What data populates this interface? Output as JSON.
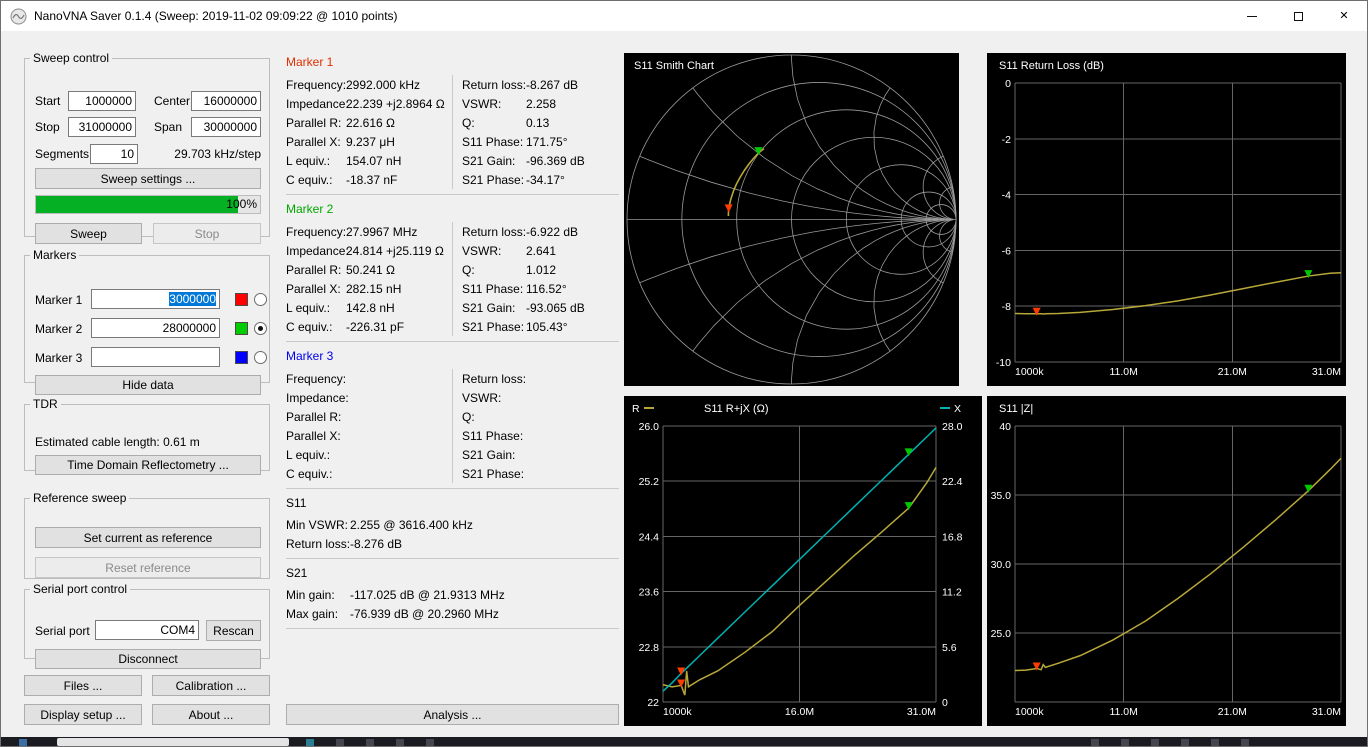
{
  "window": {
    "title": "NanoVNA Saver 0.1.4 (Sweep: 2019-11-02 09:09:22 @ 1010 points)"
  },
  "sweep_control": {
    "title": "Sweep control",
    "start_label": "Start",
    "start_value": "1000000",
    "center_label": "Center",
    "center_value": "16000000",
    "stop_label": "Stop",
    "stop_value": "31000000",
    "span_label": "Span",
    "span_value": "30000000",
    "segments_label": "Segments",
    "segments_value": "10",
    "step_info": "29.703 kHz/step",
    "sweep_settings_button": "Sweep settings ...",
    "progress_percent": 100,
    "progress_label": "100%",
    "sweep_button": "Sweep",
    "stop_button": "Stop"
  },
  "markers_panel": {
    "title": "Markers",
    "rows": [
      {
        "label": "Marker 1",
        "value": "3000000",
        "color": "#ff0000",
        "checked": false
      },
      {
        "label": "Marker 2",
        "value": "28000000",
        "color": "#00cc00",
        "checked": true
      },
      {
        "label": "Marker 3",
        "value": "",
        "color": "#0000ff",
        "checked": false
      }
    ],
    "hide_data_button": "Hide data"
  },
  "tdr": {
    "title": "TDR",
    "cable_length_text": "Estimated cable length: 0.61 m",
    "tdr_button": "Time Domain Reflectometry ..."
  },
  "reference": {
    "title": "Reference sweep",
    "set_button": "Set current as reference",
    "reset_button": "Reset reference"
  },
  "serial": {
    "title": "Serial port control",
    "port_label": "Serial port",
    "port_value": "COM4",
    "rescan_button": "Rescan",
    "disconnect_button": "Disconnect"
  },
  "footer_buttons": {
    "files": "Files ...",
    "calibration": "Calibration ...",
    "display_setup": "Display setup ...",
    "about": "About ...",
    "analysis": "Analysis ..."
  },
  "marker_data": [
    {
      "title": "Marker 1",
      "color": "#e03000",
      "left": [
        [
          "Frequency:",
          "2992.000 kHz"
        ],
        [
          "Impedance:",
          "22.239 +j2.8964 Ω"
        ],
        [
          "Parallel R:",
          "22.616 Ω"
        ],
        [
          "Parallel X:",
          "9.237 μH"
        ],
        [
          "L equiv.:",
          "154.07 nH"
        ],
        [
          "C equiv.:",
          "-18.37 nF"
        ]
      ],
      "right": [
        [
          "Return loss:",
          "-8.267 dB"
        ],
        [
          "VSWR:",
          "2.258"
        ],
        [
          "Q:",
          "0.13"
        ],
        [
          "S11 Phase:",
          "171.75°"
        ],
        [
          "S21 Gain:",
          "-96.369 dB"
        ],
        [
          "S21 Phase:",
          "-34.17°"
        ]
      ]
    },
    {
      "title": "Marker 2",
      "color": "#00a800",
      "left": [
        [
          "Frequency:",
          "27.9967 MHz"
        ],
        [
          "Impedance:",
          "24.814 +j25.119 Ω"
        ],
        [
          "Parallel R:",
          "50.241 Ω"
        ],
        [
          "Parallel X:",
          "282.15 nH"
        ],
        [
          "L equiv.:",
          "142.8 nH"
        ],
        [
          "C equiv.:",
          "-226.31 pF"
        ]
      ],
      "right": [
        [
          "Return loss:",
          "-6.922 dB"
        ],
        [
          "VSWR:",
          "2.641"
        ],
        [
          "Q:",
          "1.012"
        ],
        [
          "S11 Phase:",
          "116.52°"
        ],
        [
          "S21 Gain:",
          "-93.065 dB"
        ],
        [
          "S21 Phase:",
          "105.43°"
        ]
      ]
    },
    {
      "title": "Marker 3",
      "color": "#0000ee",
      "left": [
        [
          "Frequency:",
          ""
        ],
        [
          "Impedance:",
          ""
        ],
        [
          "Parallel R:",
          ""
        ],
        [
          "Parallel X:",
          ""
        ],
        [
          "L equiv.:",
          ""
        ],
        [
          "C equiv.:",
          ""
        ]
      ],
      "right": [
        [
          "Return loss:",
          ""
        ],
        [
          "VSWR:",
          ""
        ],
        [
          "Q:",
          ""
        ],
        [
          "S11 Phase:",
          ""
        ],
        [
          "S21 Gain:",
          ""
        ],
        [
          "S21 Phase:",
          ""
        ]
      ]
    }
  ],
  "s11_stats": {
    "title": "S11",
    "rows": [
      [
        "Min VSWR:",
        "2.255 @ 3616.400 kHz"
      ],
      [
        "Return loss:",
        "-8.276 dB"
      ]
    ]
  },
  "s21_stats": {
    "title": "S21",
    "rows": [
      [
        "Min gain:",
        "-117.025 dB @ 21.9313 MHz"
      ],
      [
        "Max gain:",
        "-76.939 dB @ 20.2960 MHz"
      ]
    ]
  },
  "chart_data": [
    {
      "id": "smith",
      "type": "smith",
      "title": "S11 Smith Chart",
      "z0": 50,
      "trace_color": "#b8a83a",
      "freq": [
        1,
        2,
        3,
        3.4,
        3.6,
        3.8,
        5,
        7,
        10,
        13,
        16,
        19,
        22,
        25,
        28,
        30,
        31
      ],
      "r": [
        22.25,
        22.22,
        22.24,
        22.1,
        22.45,
        22.22,
        22.32,
        22.45,
        22.72,
        23.02,
        23.4,
        23.76,
        24.12,
        24.46,
        24.81,
        25.18,
        25.4
      ],
      "x": [
        1.1,
        1.95,
        2.9,
        3.25,
        3.43,
        3.61,
        4.68,
        6.46,
        9.13,
        11.79,
        14.46,
        17.13,
        19.8,
        22.46,
        25.13,
        26.91,
        27.8
      ],
      "markers": [
        {
          "f": 2.992,
          "color": "#ff3c00"
        },
        {
          "f": 27.9967,
          "color": "#00c800"
        }
      ]
    },
    {
      "id": "rl",
      "type": "line",
      "title": "S11 Return Loss (dB)",
      "x": [
        1,
        2,
        3,
        3.4,
        3.6,
        3.8,
        5,
        7,
        10,
        13,
        16,
        19,
        22,
        25,
        28,
        30,
        31
      ],
      "xlim": [
        1,
        31
      ],
      "series": [
        {
          "name": "S11 Return loss",
          "color": "#b8a83a",
          "axis": "left",
          "values": [
            -8.26,
            -8.27,
            -8.27,
            -8.27,
            -8.28,
            -8.27,
            -8.26,
            -8.22,
            -8.12,
            -7.98,
            -7.81,
            -7.6,
            -7.37,
            -7.14,
            -6.92,
            -6.82,
            -6.8
          ]
        }
      ],
      "left": {
        "lim": [
          -10,
          0
        ],
        "ticks": [
          {
            "v": 0,
            "label": "0"
          },
          {
            "v": -2,
            "label": "-2"
          },
          {
            "v": -4,
            "label": "-4"
          },
          {
            "v": -6,
            "label": "-6"
          },
          {
            "v": -8,
            "label": "-8"
          },
          {
            "v": -10,
            "label": "-10"
          }
        ]
      },
      "xticks": [
        {
          "v": 1,
          "label": "1000k"
        },
        {
          "v": 11,
          "label": "11.0M"
        },
        {
          "v": 21,
          "label": "21.0M"
        },
        {
          "v": 31,
          "label": "31.0M"
        }
      ],
      "markers": [
        {
          "f": 2.992,
          "series": 0,
          "color": "#ff3c00"
        },
        {
          "f": 27.9967,
          "series": 0,
          "color": "#00c800"
        }
      ]
    },
    {
      "id": "rjx",
      "type": "line",
      "title": "S11 R+jX (Ω)",
      "legend_left": {
        "label": "R",
        "color": "#b8a83a"
      },
      "legend_right": {
        "label": "X",
        "color": "#00b2b2"
      },
      "x": [
        1,
        2,
        3,
        3.4,
        3.6,
        3.8,
        5,
        7,
        10,
        13,
        16,
        19,
        22,
        25,
        28,
        30,
        31
      ],
      "xlim": [
        1,
        31
      ],
      "series": [
        {
          "name": "R",
          "color": "#b8a83a",
          "axis": "left",
          "values": [
            22.25,
            22.22,
            22.24,
            22.1,
            22.45,
            22.22,
            22.32,
            22.45,
            22.72,
            23.02,
            23.4,
            23.76,
            24.12,
            24.46,
            24.81,
            25.18,
            25.4
          ]
        },
        {
          "name": "X",
          "color": "#00b2b2",
          "axis": "right",
          "values": [
            1.1,
            1.95,
            2.9,
            3.25,
            3.43,
            3.61,
            4.68,
            6.46,
            9.13,
            11.79,
            14.46,
            17.13,
            19.8,
            22.46,
            25.13,
            26.91,
            27.8
          ]
        }
      ],
      "left": {
        "lim": [
          22,
          26
        ],
        "ticks": [
          {
            "v": 26,
            "label": "26.0"
          },
          {
            "v": 25.2,
            "label": "25.2"
          },
          {
            "v": 24.4,
            "label": "24.4"
          },
          {
            "v": 23.6,
            "label": "23.6"
          },
          {
            "v": 22.8,
            "label": "22.8"
          },
          {
            "v": 22,
            "label": "22"
          }
        ]
      },
      "right": {
        "lim": [
          0,
          28
        ],
        "ticks": [
          {
            "v": 28,
            "label": "28.0"
          },
          {
            "v": 22.4,
            "label": "22.4"
          },
          {
            "v": 16.8,
            "label": "16.8"
          },
          {
            "v": 11.2,
            "label": "11.2"
          },
          {
            "v": 5.6,
            "label": "5.6"
          },
          {
            "v": 0,
            "label": "0"
          }
        ]
      },
      "xticks": [
        {
          "v": 1,
          "label": "1000k"
        },
        {
          "v": 16,
          "label": "16.0M"
        },
        {
          "v": 31,
          "label": "31.0M"
        }
      ],
      "markers": [
        {
          "f": 2.992,
          "series": 0,
          "color": "#ff3c00"
        },
        {
          "f": 2.992,
          "series": 1,
          "color": "#ff3c00"
        },
        {
          "f": 27.9967,
          "series": 0,
          "color": "#00c800"
        },
        {
          "f": 27.9967,
          "series": 1,
          "color": "#00c800"
        }
      ]
    },
    {
      "id": "z",
      "type": "line",
      "title": "S11 |Z|",
      "x": [
        1,
        2,
        3,
        3.4,
        3.6,
        3.8,
        5,
        7,
        10,
        13,
        16,
        19,
        22,
        25,
        28,
        30,
        31
      ],
      "xlim": [
        1,
        31
      ],
      "series": [
        {
          "name": "|Z|",
          "color": "#b8a83a",
          "axis": "left",
          "values": [
            22.28,
            22.31,
            22.43,
            22.34,
            22.71,
            22.51,
            22.81,
            23.36,
            24.49,
            25.86,
            27.51,
            29.29,
            31.21,
            33.21,
            35.31,
            36.85,
            37.66
          ]
        }
      ],
      "left": {
        "lim": [
          20,
          40
        ],
        "ticks": [
          {
            "v": 40,
            "label": "40"
          },
          {
            "v": 35,
            "label": "35.0"
          },
          {
            "v": 30,
            "label": "30.0"
          },
          {
            "v": 25,
            "label": "25.0"
          }
        ]
      },
      "xticks": [
        {
          "v": 1,
          "label": "1000k"
        },
        {
          "v": 11,
          "label": "11.0M"
        },
        {
          "v": 21,
          "label": "21.0M"
        },
        {
          "v": 31,
          "label": "31.0M"
        }
      ],
      "markers": [
        {
          "f": 2.992,
          "series": 0,
          "color": "#ff3c00"
        },
        {
          "f": 27.9967,
          "series": 0,
          "color": "#00c800"
        }
      ]
    }
  ]
}
